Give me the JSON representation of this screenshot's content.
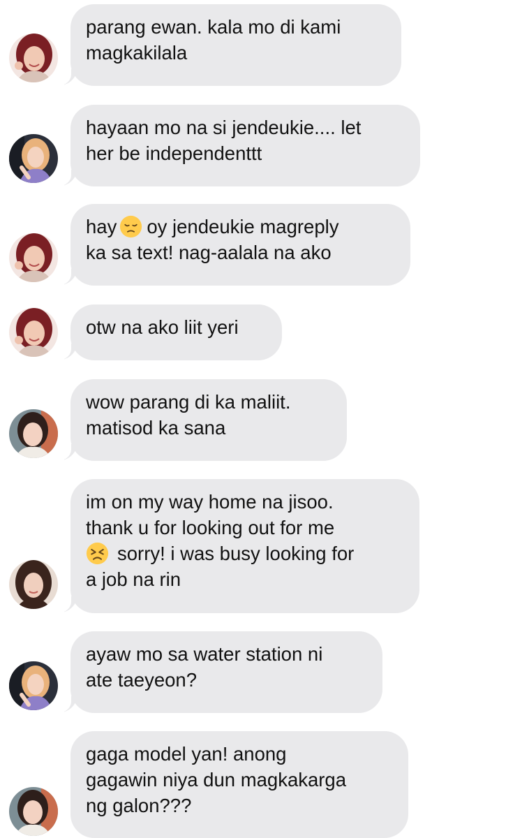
{
  "messages": [
    {
      "avatar": "jisoo",
      "lines": [
        "parang ewan. kala mo di kami",
        "magkakilala"
      ]
    },
    {
      "avatar": "rose",
      "lines": [
        "hayaan mo na si jendeukie.... let",
        "her be independenttt"
      ]
    },
    {
      "avatar": "jisoo",
      "lines_rich": [
        {
          "before": "hay",
          "emoji": "pensive-face-emoji",
          "after": "oy jendeukie magreply"
        },
        {
          "text": "ka sa text! nag-aalala na ako"
        }
      ]
    },
    {
      "avatar": "jisoo",
      "lines": [
        "otw na ako liit yeri"
      ]
    },
    {
      "avatar": "yeri",
      "lines": [
        "wow parang di ka maliit.",
        "matisod ka sana"
      ]
    },
    {
      "avatar": "jennie",
      "lines_rich": [
        {
          "text": "im on my way home na jisoo."
        },
        {
          "text": "thank u for looking out for me"
        },
        {
          "before": "",
          "emoji": "persevering-face-emoji",
          "after": "sorry! i was busy looking for"
        },
        {
          "text": "a job na rin"
        }
      ]
    },
    {
      "avatar": "rose",
      "lines": [
        "ayaw mo sa water station ni",
        "ate taeyeon?"
      ]
    },
    {
      "avatar": "yeri",
      "lines": [
        "gaga model yan! anong",
        "gagawin niya dun magkakarga",
        "ng galon???"
      ]
    }
  ],
  "colors": {
    "bubble": "#e9e9eb",
    "text": "#111111",
    "background": "#ffffff"
  }
}
